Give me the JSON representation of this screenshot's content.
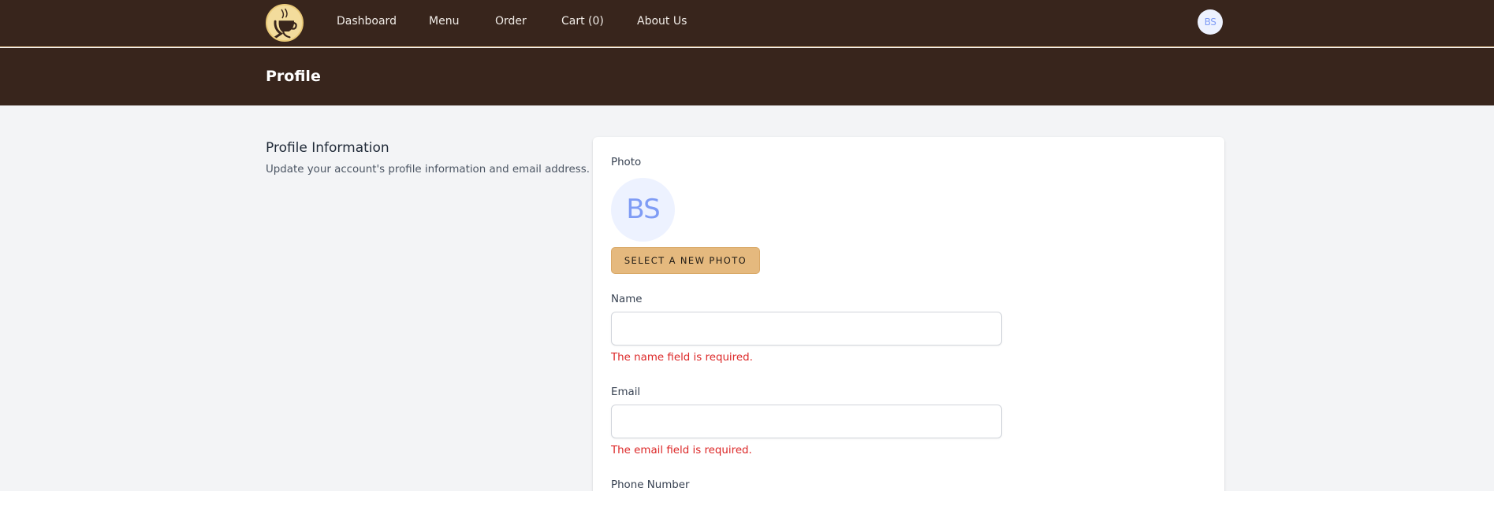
{
  "nav": {
    "items": [
      {
        "label": "Dashboard"
      },
      {
        "label": "Menu"
      },
      {
        "label": "Order"
      },
      {
        "label": "Cart (0)"
      },
      {
        "label": "About Us"
      }
    ],
    "user_initials": "BS"
  },
  "header": {
    "title": "Profile"
  },
  "profile_section": {
    "title": "Profile Information",
    "description": "Update your account's profile information and email address."
  },
  "form": {
    "photo": {
      "label": "Photo",
      "initials": "BS",
      "button_label": "Select a New Photo"
    },
    "name": {
      "label": "Name",
      "value": "",
      "error": "The name field is required."
    },
    "email": {
      "label": "Email",
      "value": "",
      "error": "The email field is required."
    },
    "phone": {
      "label": "Phone Number"
    }
  },
  "colors": {
    "nav_background": "#38251c",
    "accent_button": "#e5b97e",
    "error_text": "#dc2626",
    "avatar_background": "#edf2ff",
    "avatar_text": "#7f9cf5"
  },
  "icons": {
    "logo": "coffee-cup-logo-icon"
  }
}
